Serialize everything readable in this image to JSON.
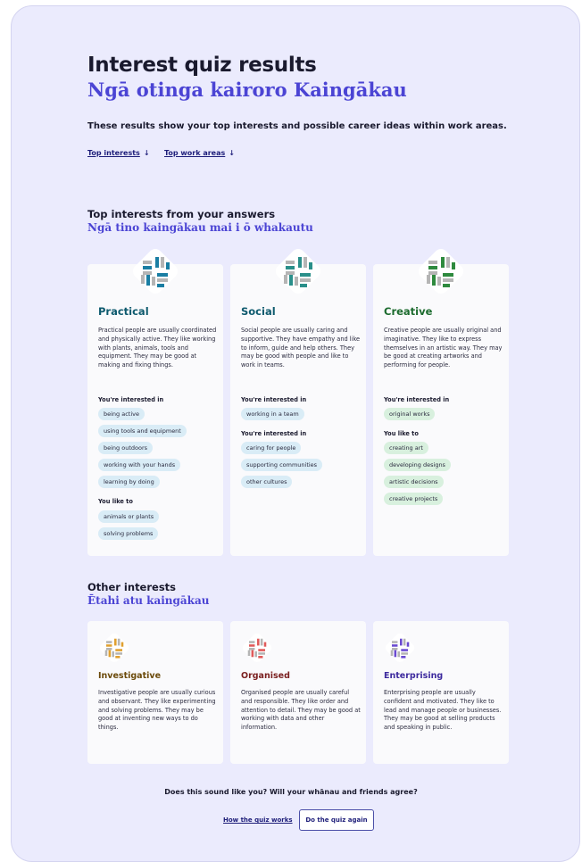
{
  "header": {
    "title": "Interest quiz results",
    "title_mi": "Ngā otinga kairoro Kaingākau",
    "intro": "These results show your top interests and possible career ideas within work areas.",
    "anchor_links": [
      {
        "label": "Top interests",
        "arrow": "↓"
      },
      {
        "label": "Top work areas",
        "arrow": "↓"
      }
    ]
  },
  "top_interests": {
    "heading": "Top interests from your answers",
    "heading_mi": "Ngā tino kaingākau mai i ō whakautu",
    "cards": [
      {
        "title": "Practical",
        "title_color": "#0e5a6e",
        "icon": "practical-weave-icon",
        "icon_color": "#1a7ea3",
        "description": "Practical people are usually coordinated and physically active. They like working with plants, animals, tools and equipment. They may be good at making and fixing things.",
        "interested_label": "You're interested in",
        "interested": [
          "being active",
          "using tools and equipment",
          "being outdoors",
          "working with your hands",
          "learning by doing"
        ],
        "like_label": "You like to",
        "like": [
          "animals or plants",
          "solving problems"
        ]
      },
      {
        "title": "Social",
        "title_color": "#0e5a6e",
        "icon": "social-weave-icon",
        "icon_color": "#2a8f8a",
        "description": "Social people are usually caring and supportive. They have empathy and like to inform, guide and help others. They may be good with people and like to work in teams.",
        "interested_label": "You're interested in",
        "interested": [
          "working in a team"
        ],
        "like_label": "You're interested in",
        "like": [
          "caring for people",
          "supporting communities",
          "other cultures"
        ]
      },
      {
        "title": "Creative",
        "title_color": "#1c6b2e",
        "icon": "creative-weave-icon",
        "icon_color": "#2e8a3e",
        "description": "Creative people are usually original and imaginative. They like to express themselves in an artistic way. They may be good at creating artworks and performing for people.",
        "interested_label": "You're interested in",
        "interested": [
          "original works"
        ],
        "like_label": "You like to",
        "like": [
          "creating art",
          "developing designs",
          "artistic decisions",
          "creative projects"
        ]
      }
    ]
  },
  "other_interests": {
    "heading": "Other interests",
    "heading_mi": "Ētahi atu kaingākau",
    "cards": [
      {
        "title": "Investigative",
        "title_color": "#6b4a0a",
        "icon": "investigative-weave-icon",
        "icon_color": "#e0a030",
        "description": "Investigative people are usually curious and observant. They like experimenting and solving problems. They may be good at inventing new ways to do things."
      },
      {
        "title": "Organised",
        "title_color": "#7a1f1f",
        "icon": "organised-weave-icon",
        "icon_color": "#e05a5a",
        "description": "Organised people are usually careful and responsible. They like order and attention to detail. They may be good at working with data and other information."
      },
      {
        "title": "Enterprising",
        "title_color": "#3d2a9e",
        "icon": "enterprising-weave-icon",
        "icon_color": "#6a4ad0",
        "description": "Enterprising people are usually confident and motivated. They like to lead and manage people or businesses. They may be good at selling products and speaking in public."
      }
    ]
  },
  "footer": {
    "question": "Does this sound like you? Will your whānau and friends agree?",
    "how_link": "How the quiz works",
    "again_button": "Do the quiz again"
  }
}
